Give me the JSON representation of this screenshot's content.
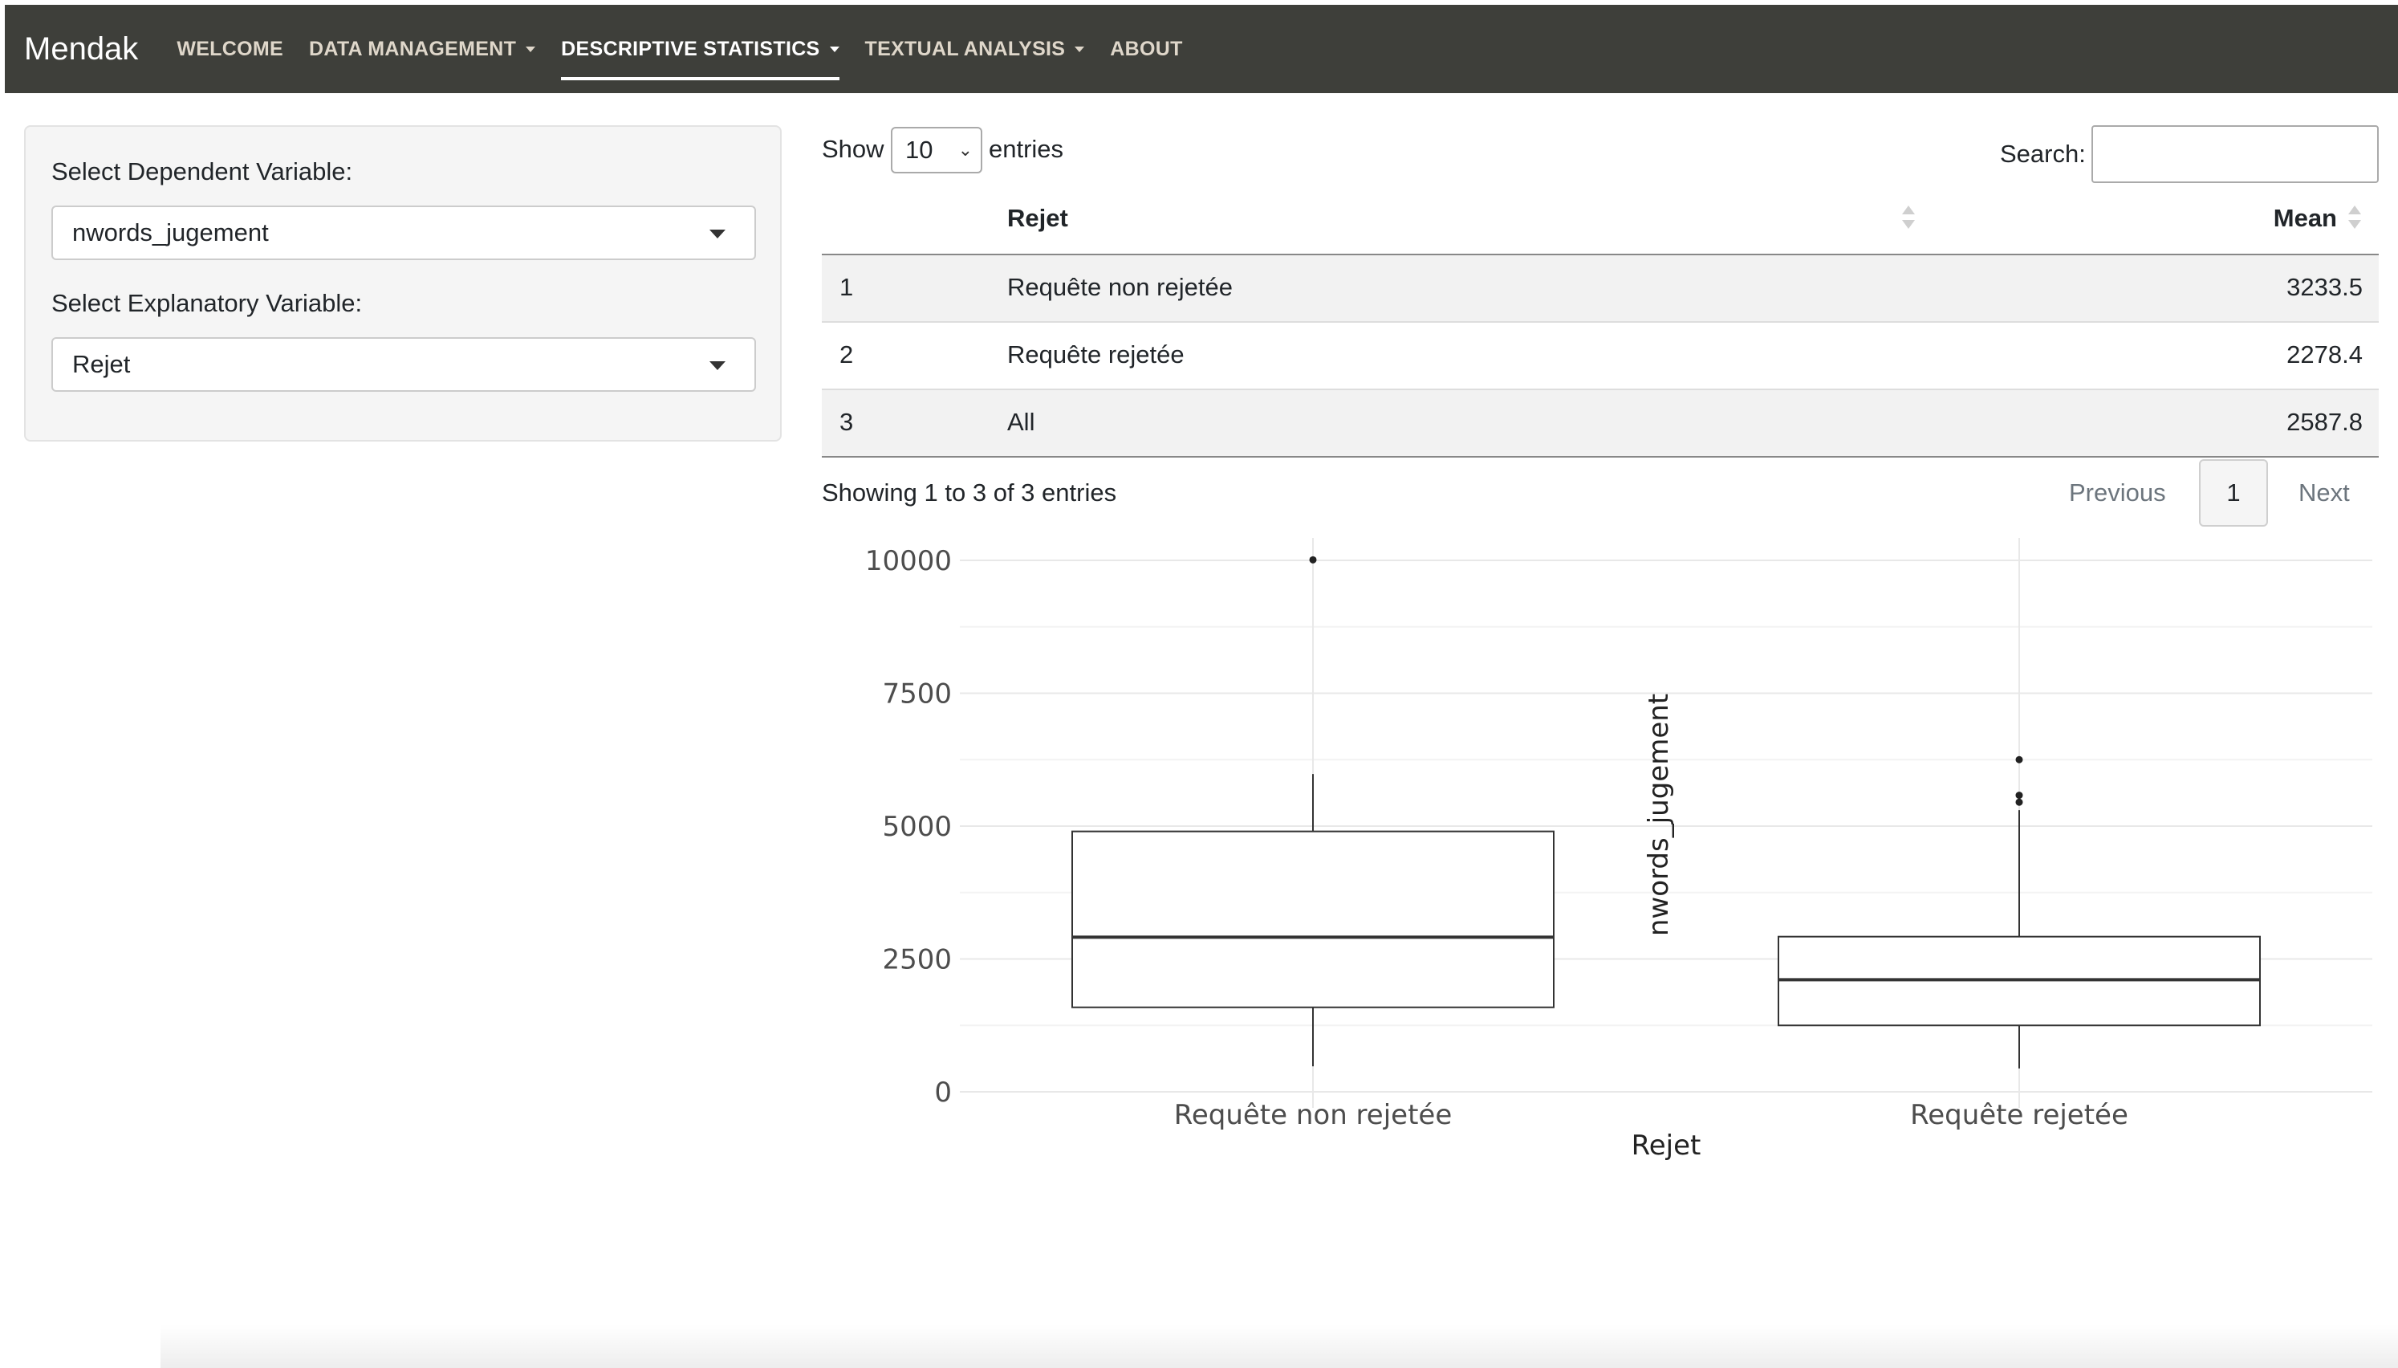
{
  "navbar": {
    "brand": "Mendak",
    "items": [
      {
        "label": "WELCOME",
        "dropdown": false,
        "active": false
      },
      {
        "label": "DATA MANAGEMENT",
        "dropdown": true,
        "active": false
      },
      {
        "label": "DESCRIPTIVE STATISTICS",
        "dropdown": true,
        "active": true
      },
      {
        "label": "TEXTUAL ANALYSIS",
        "dropdown": true,
        "active": false
      },
      {
        "label": "ABOUT",
        "dropdown": false,
        "active": false
      }
    ]
  },
  "sidebar": {
    "dependent_label": "Select Dependent Variable:",
    "dependent_value": "nwords_jugement",
    "explanatory_label": "Select Explanatory Variable:",
    "explanatory_value": "Rejet"
  },
  "table_controls": {
    "show_label": "Show",
    "page_length": "10",
    "entries_label": "entries",
    "search_label": "Search:",
    "search_value": ""
  },
  "table": {
    "columns": [
      "",
      "Rejet",
      "Mean"
    ],
    "rows": [
      [
        "1",
        "Requête non rejetée",
        "3233.5"
      ],
      [
        "2",
        "Requête rejetée",
        "2278.4"
      ],
      [
        "3",
        "All",
        "2587.8"
      ]
    ],
    "info": "Showing 1 to 3 of 3 entries"
  },
  "pagination": {
    "previous": "Previous",
    "current": "1",
    "next": "Next"
  },
  "chart_data": {
    "type": "boxplot",
    "xlabel": "Rejet",
    "ylabel": "nwords_jugement",
    "ylim": [
      0,
      10500
    ],
    "yticks": [
      0,
      2500,
      5000,
      7500,
      10000
    ],
    "grid": true,
    "categories": [
      "Requête non rejetée",
      "Requête rejetée"
    ],
    "boxes": [
      {
        "category": "Requête non rejetée",
        "whisker_low": 480,
        "q1": 1590,
        "median": 2910,
        "q3": 4900,
        "whisker_high": 5980,
        "outliers": [
          10010
        ]
      },
      {
        "category": "Requête rejetée",
        "whisker_low": 440,
        "q1": 1250,
        "median": 2110,
        "q3": 2920,
        "whisker_high": 5300,
        "outliers": [
          5450,
          5580,
          6250
        ]
      }
    ]
  }
}
